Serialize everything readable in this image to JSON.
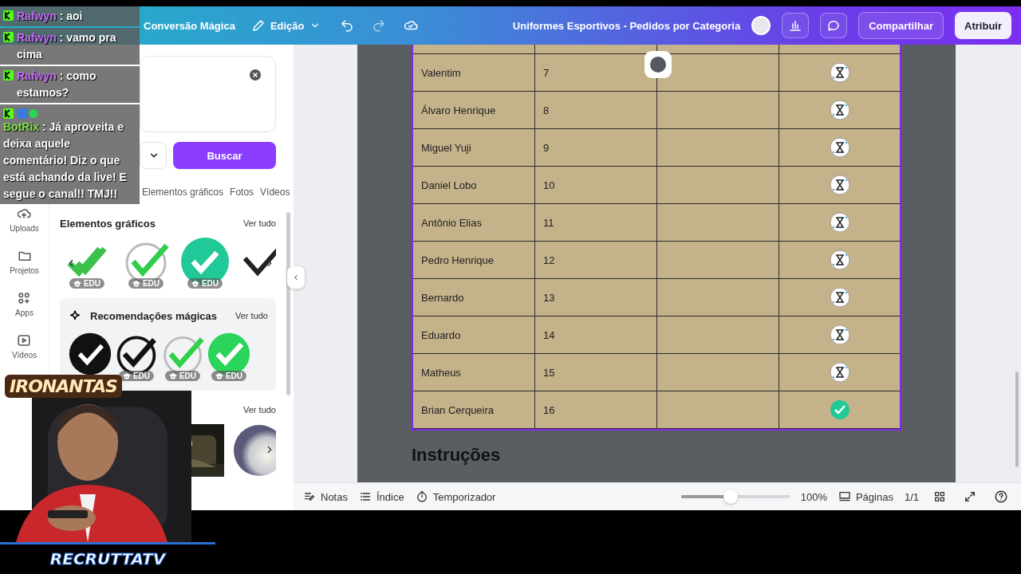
{
  "header": {
    "menu": [
      {
        "label": "Conversão Mágica",
        "kind": "text"
      },
      {
        "label": "Edição",
        "kind": "edit"
      }
    ],
    "title": "Uniformes Esportivos - Pedidos por Categoria",
    "share": "Compartilhar",
    "assign": "Atribuir"
  },
  "rail": [
    {
      "label": "Uploads",
      "kind": "upload"
    },
    {
      "label": "Projetos",
      "kind": "folder"
    },
    {
      "label": "Apps",
      "kind": "apps"
    },
    {
      "label": "Vídeos",
      "kind": "video"
    }
  ],
  "panel": {
    "search_button": "Buscar",
    "tabs": [
      {
        "label": "Elementos gráficos",
        "selected": false
      },
      {
        "label": "Fotos",
        "selected": false
      },
      {
        "label": "Vídeos",
        "selected": false
      }
    ],
    "sections": [
      {
        "title": "Elementos gráficos",
        "link": "Ver tudo",
        "kind": "plain",
        "items": [
          {
            "kind": "double-check",
            "badge": "EDU"
          },
          {
            "kind": "ring-check",
            "badge": "EDU"
          },
          {
            "kind": "disc-check",
            "badge": "EDU"
          },
          {
            "kind": "black-check"
          }
        ]
      },
      {
        "title": "Recomendações mágicas",
        "link": "Ver tudo",
        "kind": "magic",
        "items": [
          {
            "kind": "black-disc"
          },
          {
            "kind": "ring-black-check",
            "badge": "EDU"
          },
          {
            "kind": "ring-check",
            "badge": "EDU"
          },
          {
            "kind": "green-disc",
            "badge": "EDU"
          }
        ]
      },
      {
        "link": "Ver tudo",
        "kind": "photos",
        "items": [
          {
            "kind": "picture"
          },
          {
            "kind": "sphere"
          }
        ]
      }
    ]
  },
  "table": {
    "rows": [
      {
        "name": "Valentim",
        "number": "7",
        "kind": "pending"
      },
      {
        "name": "Álvaro Henrique",
        "number": "8",
        "kind": "pending"
      },
      {
        "name": "Miguel Yuji",
        "number": "9",
        "kind": "pending"
      },
      {
        "name": "Daniel Lobo",
        "number": "10",
        "kind": "pending"
      },
      {
        "name": "Antônio Elias",
        "number": "11",
        "kind": "pending"
      },
      {
        "name": "Pedro Henrique",
        "number": "12",
        "kind": "pending"
      },
      {
        "name": "Bernardo",
        "number": "13",
        "kind": "pending"
      },
      {
        "name": "Eduardo",
        "number": "14",
        "kind": "pending"
      },
      {
        "name": "Matheus",
        "number": "15",
        "kind": "pending"
      },
      {
        "name": "Brian Cerqueira",
        "number": "16",
        "kind": "done"
      }
    ]
  },
  "heading": "Instruções",
  "footer": {
    "notes": "Notas",
    "index": "Índice",
    "timer": "Temporizador",
    "zoom": {
      "level": 0.46
    },
    "zoom_reading": "100%",
    "pages": "Páginas",
    "page_count": "1/1"
  },
  "chat": [
    {
      "user": "Rafwyn",
      "text": ": aoi",
      "color": "#c06cf0",
      "bot": false
    },
    {
      "user": "Rafwyn",
      "text": ": vamo pra cima",
      "color": "#c06cf0",
      "bot": false
    },
    {
      "user": "Rafwyn",
      "text": ": como estamos?",
      "color": "#c06cf0",
      "bot": false
    },
    {
      "user": "BotRix",
      "text": ": Já aproveita e deixa aquele comentário! Diz o que está achando da live! E segue o canal!! TMJ!!",
      "color": "#7ee04a",
      "bot": true
    }
  ],
  "stream_logos": {
    "top": "IRONANTAS",
    "bottom": "RECRUTTATV"
  }
}
